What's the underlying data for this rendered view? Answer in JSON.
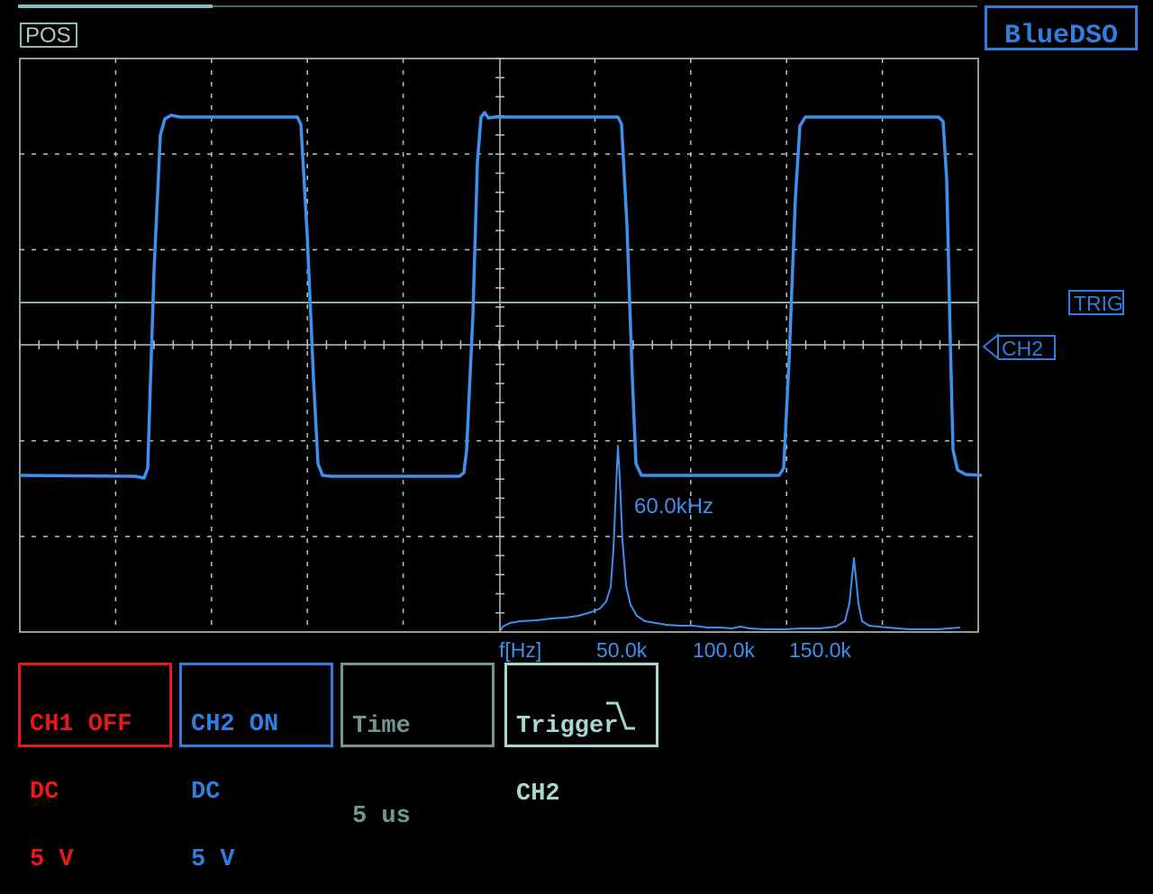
{
  "app": {
    "brand": "BlueDSO",
    "pos_label": "POS",
    "trig_label": "TRIG",
    "ch2_marker": "CH2"
  },
  "colors": {
    "background": "#000000",
    "grid": "#b8c4c4",
    "border": "#c0d0d0",
    "trace_ch2": "#3d8ff0",
    "label_blue": "#2f7ee0",
    "ch1_red": "#e81818",
    "time_gray": "#6f9890",
    "trigger_teal": "#a8d6d0",
    "scroll_teal": "#7fbfb8",
    "trig_line": "#8ab0b0"
  },
  "icons": {
    "trigger_edge": "falling-edge-icon",
    "ch2_marker": "left-triangle-icon"
  },
  "fft": {
    "peak_label": "60.0kHz",
    "axis_unit": "f[Hz]",
    "ticks": [
      "50.0k",
      "100.0k",
      "150.0k"
    ]
  },
  "panels": {
    "ch1": {
      "title": "CH1 OFF",
      "coupling": "DC",
      "scale": "5 V"
    },
    "ch2": {
      "title": "CH2 ON",
      "coupling": "DC",
      "scale": "5 V"
    },
    "time": {
      "title": "Time",
      "scale": "5 us"
    },
    "trigger": {
      "title": "Trigger",
      "source": "CH2"
    }
  }
}
